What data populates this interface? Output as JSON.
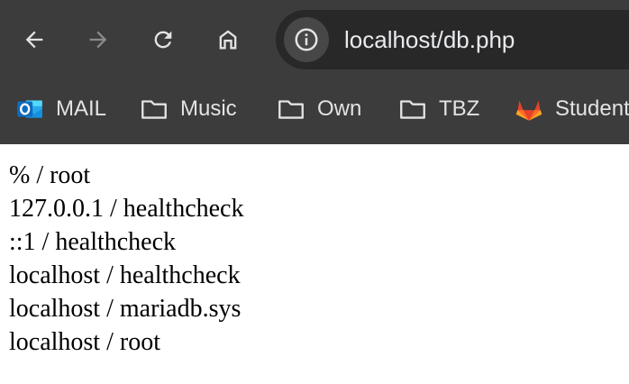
{
  "browser": {
    "url": "localhost/db.php",
    "bookmarks": [
      {
        "label": "MAIL",
        "icon": "outlook-icon"
      },
      {
        "label": "Music",
        "icon": "folder-icon"
      },
      {
        "label": "Own",
        "icon": "folder-icon"
      },
      {
        "label": "TBZ",
        "icon": "folder-icon"
      },
      {
        "label": "Student",
        "icon": "gitlab-icon"
      }
    ],
    "colors": {
      "toolbar_bg": "#3c3c3c",
      "omnibox_bg": "#282828",
      "text_light": "#e3e3e3",
      "gitlab_orange": "#fc6d26",
      "outlook_blue": "#0f6cbd"
    }
  },
  "page": {
    "lines": [
      "% / root",
      "127.0.0.1 / healthcheck",
      "::1 / healthcheck",
      "localhost / healthcheck",
      "localhost / mariadb.sys",
      "localhost / root"
    ]
  }
}
